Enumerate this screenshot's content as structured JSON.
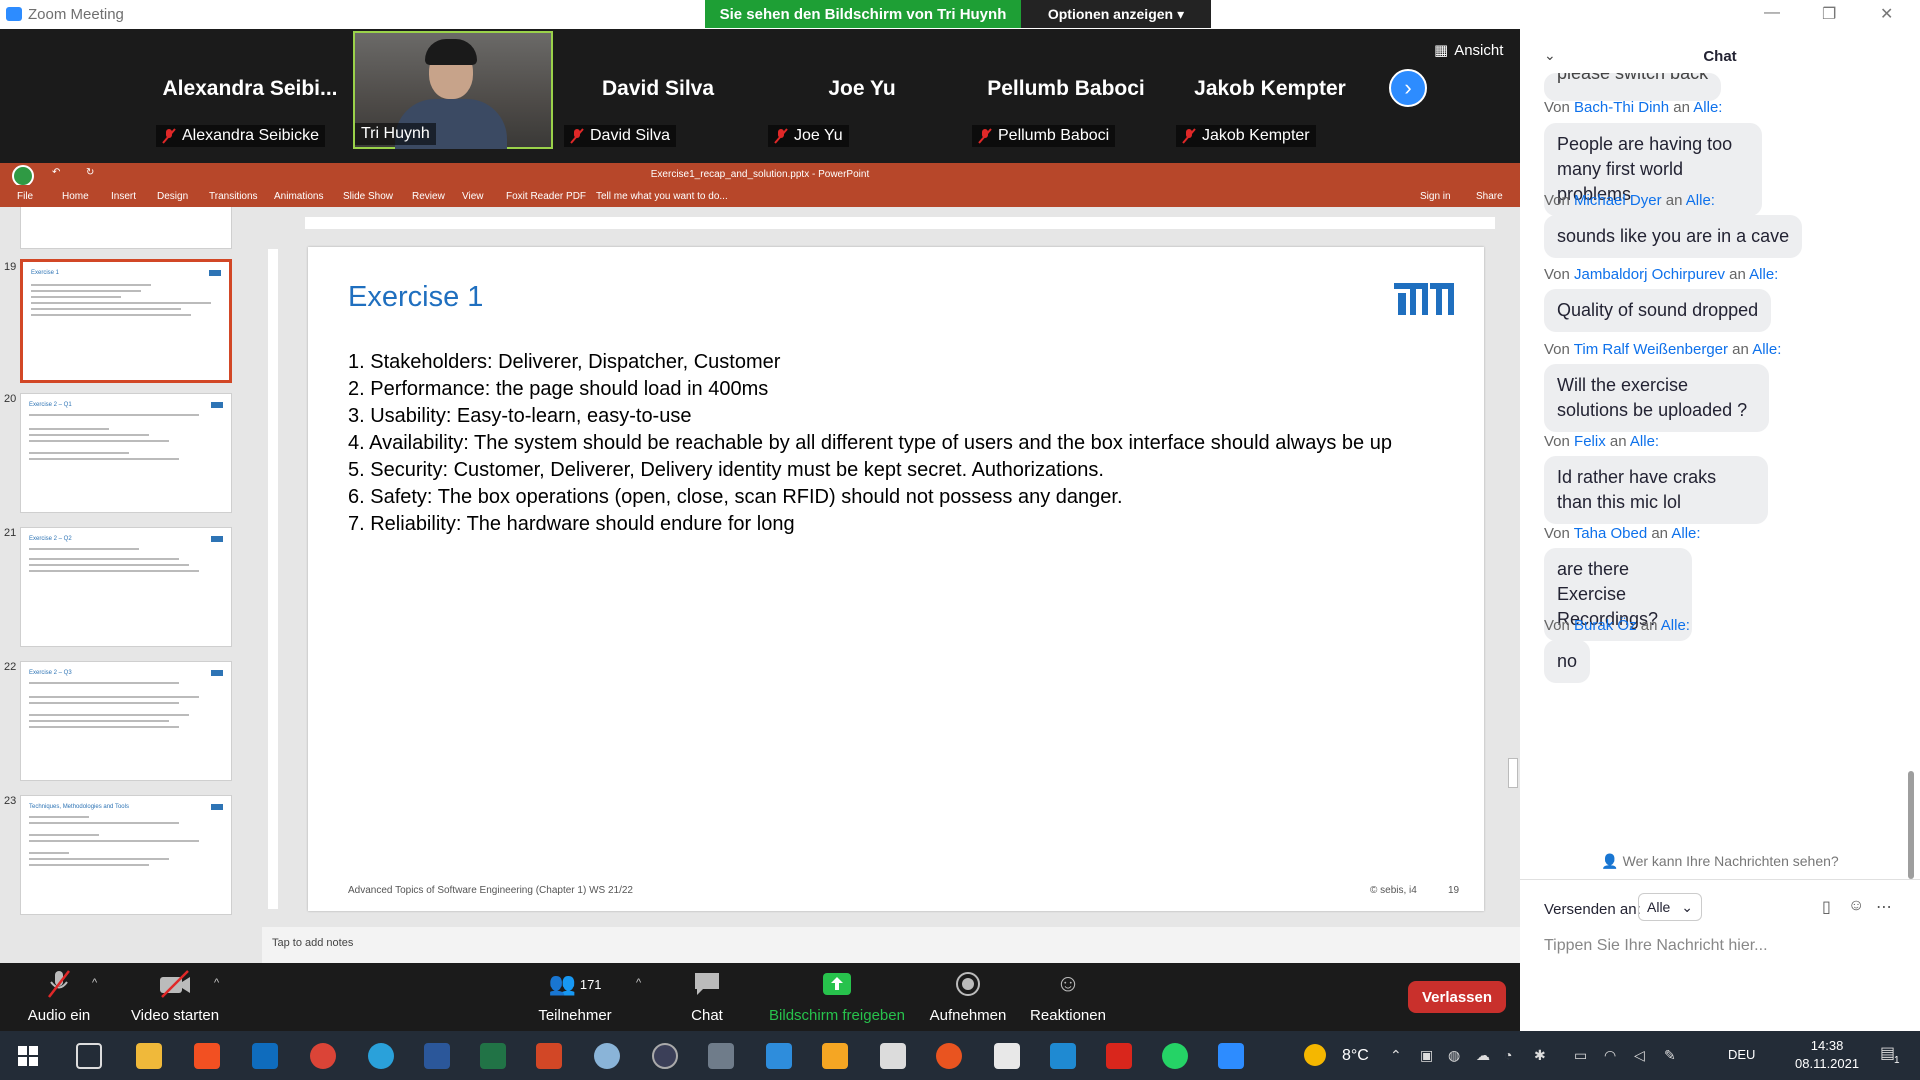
{
  "titlebar": {
    "app_title": "Zoom Meeting",
    "share_banner": "Sie sehen den Bildschirm von Tri Huynh",
    "options_label": "Optionen anzeigen"
  },
  "gallery": {
    "tiles": [
      {
        "big_name": "Alexandra  Seibi...",
        "name": "Alexandra Seibicke"
      },
      {
        "big_name": "",
        "name": "Tri Huynh"
      },
      {
        "big_name": "David Silva",
        "name": "David Silva"
      },
      {
        "big_name": "Joe Yu",
        "name": "Joe Yu"
      },
      {
        "big_name": "Pellumb Baboci",
        "name": "Pellumb Baboci"
      },
      {
        "big_name": "Jakob Kempter",
        "name": "Jakob Kempter"
      }
    ],
    "view_label": "Ansicht"
  },
  "ppt": {
    "window_title": "Exercise1_recap_and_solution.pptx - PowerPoint",
    "tabs": [
      "File",
      "Home",
      "Insert",
      "Design",
      "Transitions",
      "Animations",
      "Slide Show",
      "Review",
      "View",
      "Foxit Reader PDF",
      "Tell me what you want to do..."
    ],
    "signin": "Sign in",
    "share": "Share",
    "thumb_numbers": [
      "19",
      "20",
      "21",
      "22",
      "23"
    ],
    "slide": {
      "title": "Exercise 1",
      "lines": [
        "1. Stakeholders: Deliverer, Dispatcher, Customer",
        "2. Performance: the page should load in 400ms",
        "3. Usability: Easy-to-learn, easy-to-use",
        "4. Availability: The system should be reachable by all different type of users and the box interface should always be up",
        "5. Security: Customer, Deliverer, Delivery identity must be kept secret. Authorizations.",
        "6. Safety: The box operations (open, close, scan RFID) should not possess any danger.",
        "7. Reliability: The hardware should endure for long"
      ],
      "footer": "Advanced Topics of Software Engineering (Chapter 1) WS 21/22",
      "copyright": "© sebis, i4",
      "number": "19"
    },
    "notes_placeholder": "Tap to add notes"
  },
  "chat": {
    "title": "Chat",
    "partial_message": "please switch back",
    "messages": [
      {
        "from": "Bach-Thi Dinh",
        "to": "Alle:",
        "text": "People are having too many first world problems"
      },
      {
        "from": "Michael Dyer",
        "to": "Alle:",
        "text": "sounds like you are in a cave"
      },
      {
        "from": "Jambaldorj Ochirpurev",
        "to": "Alle:",
        "text": "Quality of sound dropped"
      },
      {
        "from": "Tim Ralf Weißenberger",
        "to": "Alle:",
        "text": "Will the exercise solutions be uploaded ?"
      },
      {
        "from": "Felix",
        "to": "Alle:",
        "text": "Id rather have craks than this mic lol"
      },
      {
        "from": "Taha Obed",
        "to": "Alle:",
        "text": "are there Exercise Recordings?"
      },
      {
        "from": "Burak Öz",
        "to": "Alle:",
        "text": "no"
      }
    ],
    "from_prefix": "Von",
    "to_word": "an",
    "who_can_see": "Wer kann Ihre Nachrichten sehen?",
    "send_to_label": "Versenden an:",
    "send_to_value": "Alle",
    "input_placeholder": "Tippen Sie Ihre Nachricht hier..."
  },
  "toolbar": {
    "audio": "Audio ein",
    "video": "Video starten",
    "participants": "Teilnehmer",
    "participants_count": "171",
    "chat": "Chat",
    "share": "Bildschirm freigeben",
    "record": "Aufnehmen",
    "reactions": "Reaktionen",
    "leave": "Verlassen"
  },
  "taskbar": {
    "weather": "8°C",
    "lang": "DEU",
    "time": "14:38",
    "date": "08.11.2021",
    "notifications": "1"
  },
  "colors": {
    "zoom_blue": "#2d8cff",
    "share_green": "#1e9f35",
    "ppt_orange": "#b7472a",
    "leave_red": "#c9302c",
    "tum_blue": "#1f6fbf"
  }
}
